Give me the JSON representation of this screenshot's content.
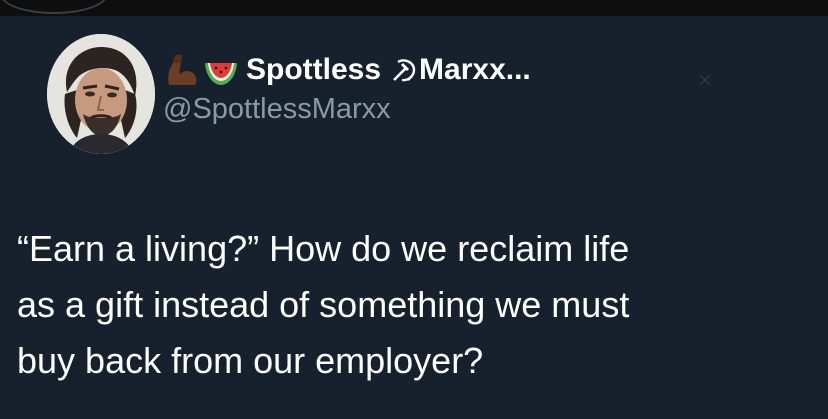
{
  "tweet": {
    "author": {
      "display_name_prefix": "Spottless ",
      "display_name_suffix": "Marxx...",
      "handle": "@SpottlessMarxx",
      "name_emojis": [
        "flexed-biceps-emoji",
        "watermelon-emoji"
      ],
      "name_symbol": "hammer-and-sickle-icon"
    },
    "text_lines": [
      "“Earn a living?” How do we reclaim life",
      "as a gift instead of something we must",
      "buy back from our employer?"
    ]
  },
  "colors": {
    "background": "#17212d",
    "top_band": "#0e0e0f",
    "text_primary": "#ffffff",
    "text_secondary": "#8b98a5"
  }
}
